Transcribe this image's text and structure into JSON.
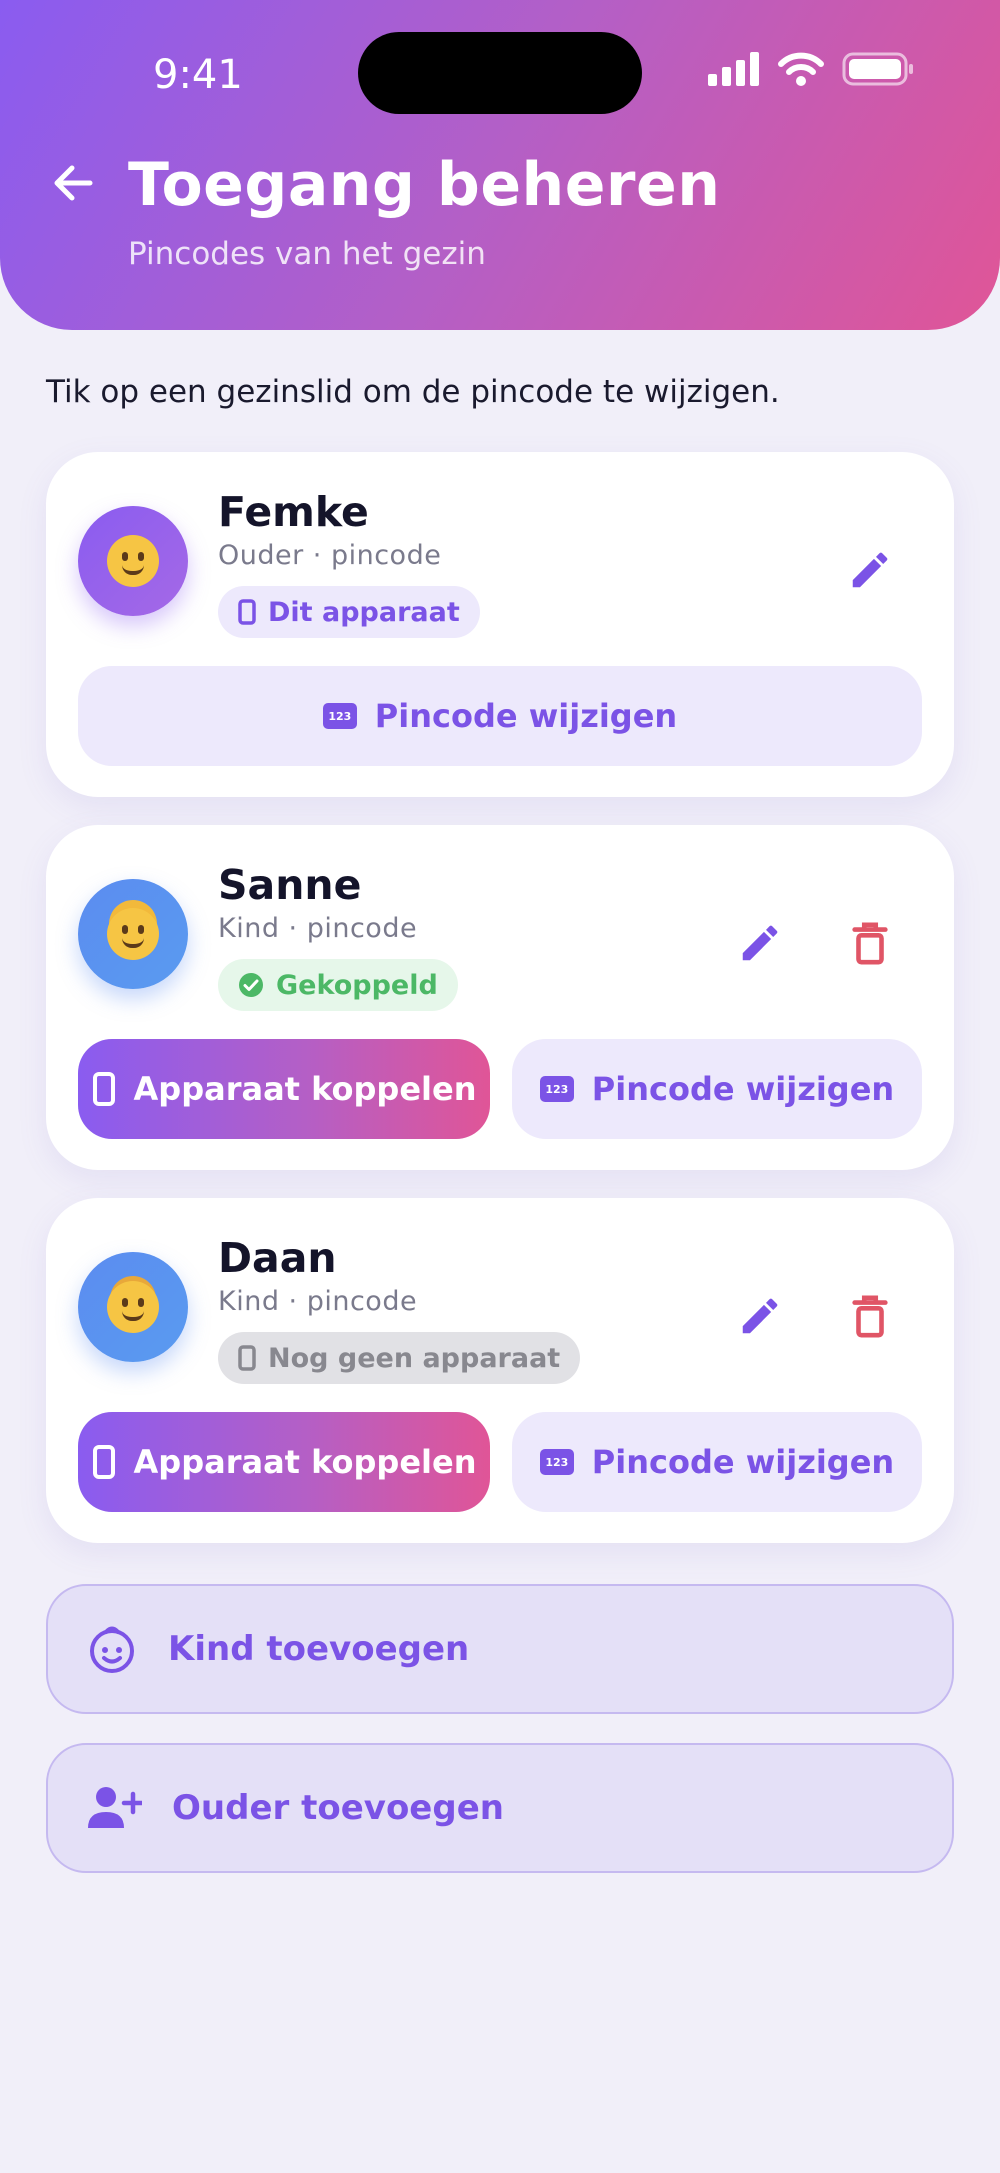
{
  "status_bar": {
    "time": "9:41"
  },
  "header": {
    "title": "Toegang beheren",
    "subtitle": "Pincodes van het gezin"
  },
  "intro_text": "Tik op een gezinslid om de pincode te wijzigen.",
  "members": [
    {
      "name": "Femke",
      "role": "Ouder · pincode",
      "status": "Dit apparaat",
      "avatar_icon": "smiling-face-icon",
      "change_pin_label": "Pincode wijzigen"
    },
    {
      "name": "Sanne",
      "role": "Kind · pincode",
      "status": "Gekoppeld",
      "avatar_icon": "girl-face-icon",
      "link_device_label": "Apparaat koppelen",
      "change_pin_label": "Pincode wijzigen"
    },
    {
      "name": "Daan",
      "role": "Kind · pincode",
      "status": "Nog geen apparaat",
      "avatar_icon": "boy-face-icon",
      "link_device_label": "Apparaat koppelen",
      "change_pin_label": "Pincode wijzigen"
    }
  ],
  "actions": {
    "add_child": "Kind toevoegen",
    "add_parent": "Ouder toevoegen"
  },
  "pin_badge_text": "123",
  "colors": {
    "accent": "#7b53e6",
    "gradient_start": "#8a5cf0",
    "gradient_end": "#e05597",
    "danger": "#e05566",
    "success": "#4cb866"
  }
}
